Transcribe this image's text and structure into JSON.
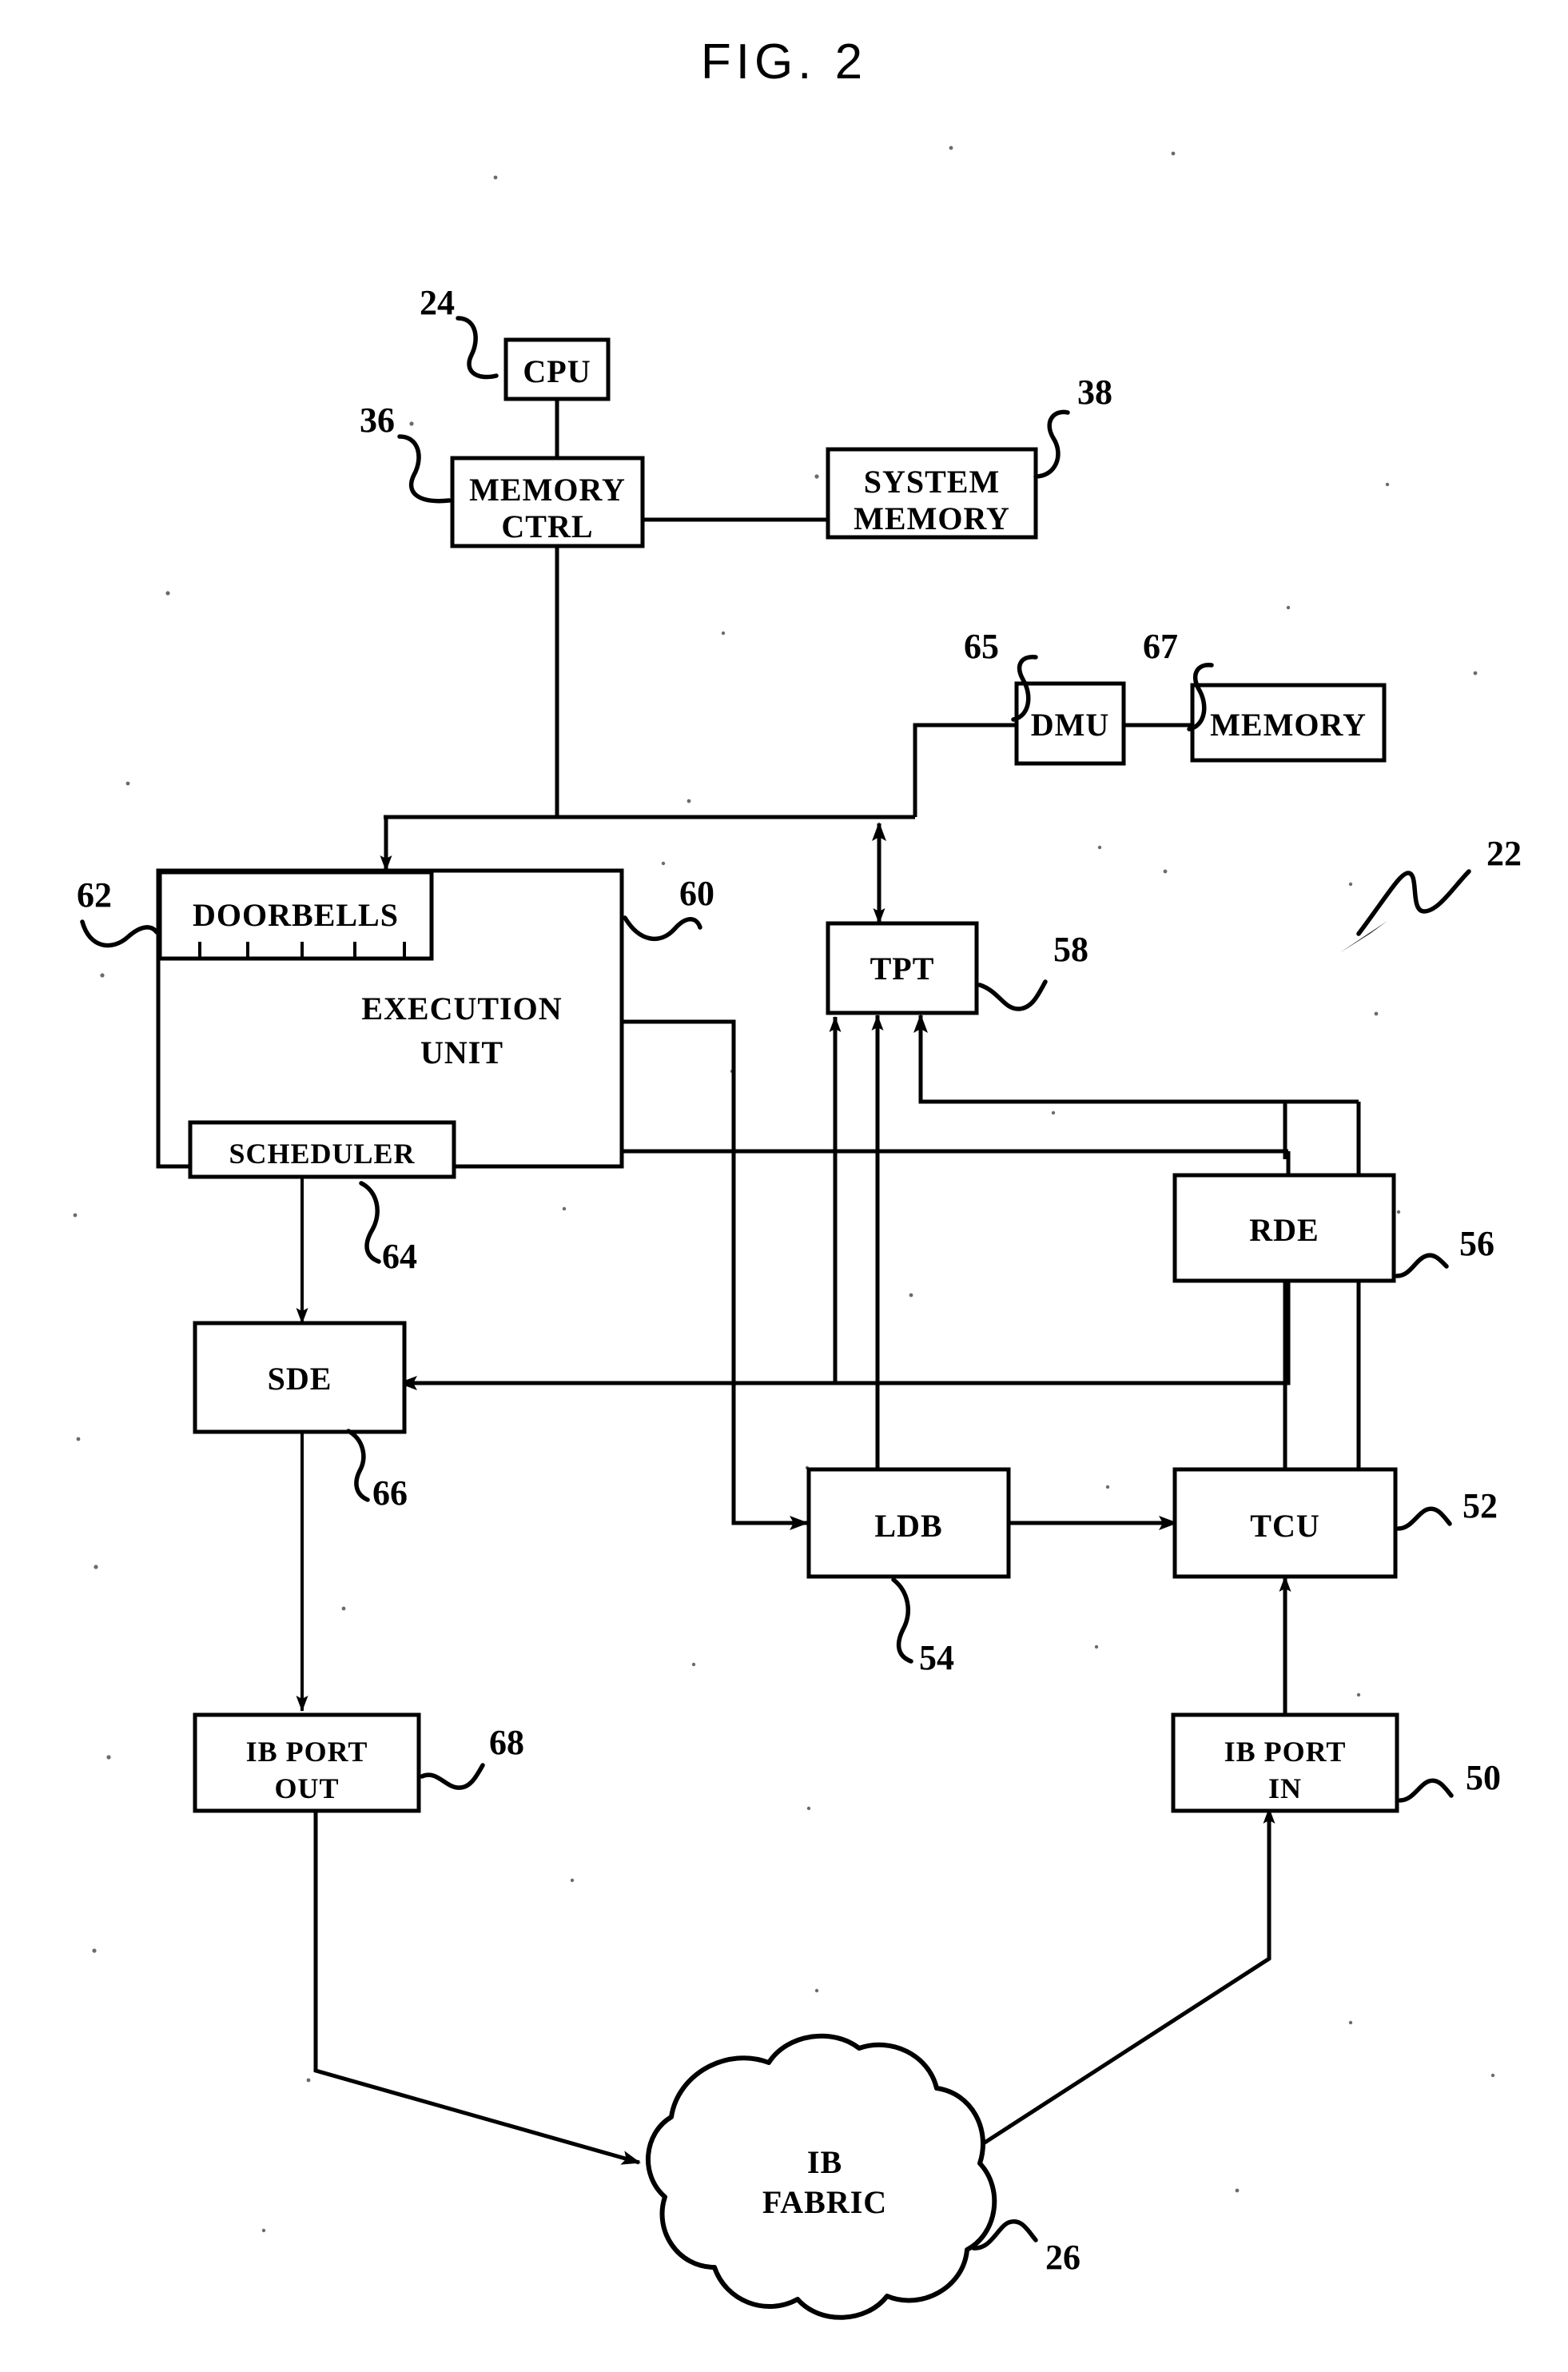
{
  "figure": {
    "title": "FIG. 2",
    "assembly_ref": "22"
  },
  "blocks": [
    {
      "id": "cpu",
      "label": "CPU",
      "ref": "24"
    },
    {
      "id": "memory_ctrl",
      "label_line1": "MEMORY",
      "label_line2": "CTRL",
      "ref": "36"
    },
    {
      "id": "system_memory",
      "label_line1": "SYSTEM",
      "label_line2": "MEMORY",
      "ref": "38"
    },
    {
      "id": "dmu",
      "label": "DMU",
      "ref": "65"
    },
    {
      "id": "memory",
      "label": "MEMORY",
      "ref": "67"
    },
    {
      "id": "execution_unit",
      "label_line1": "EXECUTION",
      "label_line2": "UNIT",
      "ref": "60"
    },
    {
      "id": "doorbells",
      "label": "DOORBELLS",
      "ref": "62"
    },
    {
      "id": "scheduler",
      "label": "SCHEDULER",
      "ref": "64"
    },
    {
      "id": "tpt",
      "label": "TPT",
      "ref": "58"
    },
    {
      "id": "rde",
      "label": "RDE",
      "ref": "56"
    },
    {
      "id": "sde",
      "label": "SDE",
      "ref": "66"
    },
    {
      "id": "ldb",
      "label": "LDB",
      "ref": "54"
    },
    {
      "id": "tcu",
      "label": "TCU",
      "ref": "52"
    },
    {
      "id": "ib_port_out",
      "label_line1": "IB  PORT",
      "label_line2": "OUT",
      "ref": "68"
    },
    {
      "id": "ib_port_in",
      "label_line1": "IB  PORT",
      "label_line2": "IN",
      "ref": "50"
    },
    {
      "id": "ib_fabric",
      "label_line1": "IB",
      "label_line2": "FABRIC",
      "ref": "26"
    }
  ],
  "refs": {
    "cpu": "24",
    "memory_ctrl": "36",
    "system_memory": "38",
    "dmu": "65",
    "memory": "67",
    "execution_unit": "60",
    "doorbells": "62",
    "scheduler": "64",
    "tpt": "58",
    "rde": "56",
    "sde": "66",
    "ldb": "54",
    "tcu": "52",
    "ib_port_out": "68",
    "ib_port_in": "50",
    "ib_fabric": "26",
    "assembly": "22"
  },
  "labels": {
    "cpu": "CPU",
    "memory_ctrl_1": "MEMORY",
    "memory_ctrl_2": "CTRL",
    "system_memory_1": "SYSTEM",
    "system_memory_2": "MEMORY",
    "dmu": "DMU",
    "memory": "MEMORY",
    "doorbells": "DOORBELLS",
    "execution_unit_1": "EXECUTION",
    "execution_unit_2": "UNIT",
    "scheduler": "SCHEDULER",
    "tpt": "TPT",
    "rde": "RDE",
    "sde": "SDE",
    "ldb": "LDB",
    "tcu": "TCU",
    "ib_port_out_1": "IB  PORT",
    "ib_port_out_2": "OUT",
    "ib_port_in_1": "IB  PORT",
    "ib_port_in_2": "IN",
    "ib_fabric_1": "IB",
    "ib_fabric_2": "FABRIC"
  },
  "connections": [
    {
      "from": "cpu",
      "to": "memory_ctrl",
      "arrow": "none"
    },
    {
      "from": "memory_ctrl",
      "to": "system_memory",
      "arrow": "none"
    },
    {
      "from": "memory_ctrl",
      "to": "doorbells",
      "arrow": "to"
    },
    {
      "from": "memory_ctrl",
      "to": "dmu",
      "arrow": "to"
    },
    {
      "from": "dmu",
      "to": "memory",
      "arrow": "none"
    },
    {
      "from": "dmu",
      "to": "tpt",
      "arrow": "both"
    },
    {
      "from": "doorbells",
      "to": "scheduler",
      "arrow": "to"
    },
    {
      "from": "scheduler",
      "to": "sde",
      "arrow": "to"
    },
    {
      "from": "execution_unit",
      "to": "ldb",
      "arrow": "to"
    },
    {
      "from": "execution_unit",
      "to": "sde",
      "arrow": "to"
    },
    {
      "from": "ldb",
      "to": "tcu",
      "arrow": "to"
    },
    {
      "from": "ldb",
      "to": "tpt",
      "arrow": "to"
    },
    {
      "from": "tcu",
      "to": "tpt",
      "arrow": "to"
    },
    {
      "from": "tcu",
      "to": "rde",
      "arrow": "to"
    },
    {
      "from": "rde",
      "to": "tpt",
      "arrow": "to"
    },
    {
      "from": "ib_port_in",
      "to": "tcu",
      "arrow": "to"
    },
    {
      "from": "ib_fabric",
      "to": "ib_port_in",
      "arrow": "to"
    },
    {
      "from": "sde",
      "to": "ib_port_out",
      "arrow": "to"
    },
    {
      "from": "ib_port_out",
      "to": "ib_fabric",
      "arrow": "to"
    }
  ]
}
